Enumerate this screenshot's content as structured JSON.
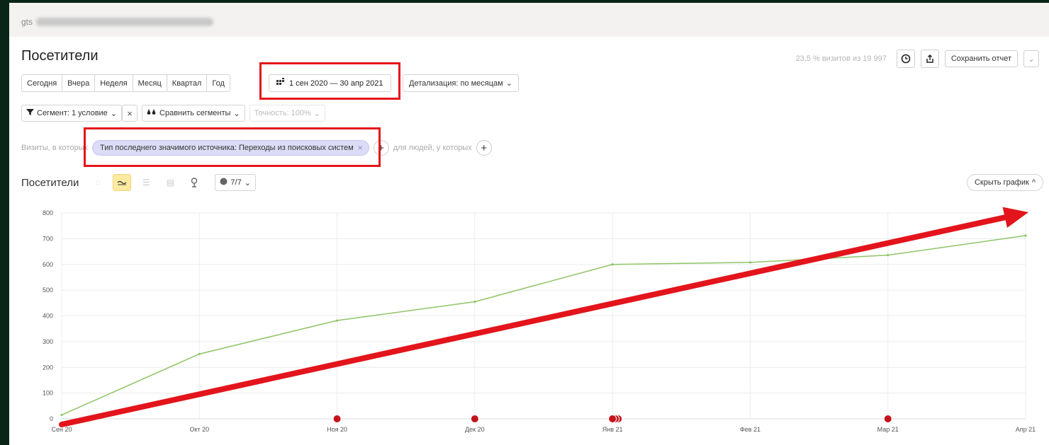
{
  "header": {
    "site_visible": "gts"
  },
  "page_title": "Посетители",
  "topright": {
    "visits_note": "23,5 % визитов из 19 997",
    "history_icon": "clock-icon",
    "export_icon": "share-icon",
    "save_label": "Сохранить отчет",
    "dropdown_icon": "chevron-down-icon"
  },
  "periods": [
    "Сегодня",
    "Вчера",
    "Неделя",
    "Месяц",
    "Квартал",
    "Год"
  ],
  "date_range": {
    "icon": "calendar-icon",
    "label": "1 сен 2020 — 30 апр 2021"
  },
  "detail": {
    "label": "Детализация: по месяцам",
    "chevron": "⌄"
  },
  "segment": {
    "segment_label": "Сегмент: 1 условие",
    "clear": "×",
    "compare_label": "Сравнить сегменты",
    "accuracy_label": "Точность: 100%"
  },
  "filter": {
    "prefix": "Визиты, в которых",
    "chip_label": "Тип последнего значимого источника: Переходы из поисковых систем",
    "chip_close": "×",
    "people_label": "для людей, у которых",
    "plus": "+"
  },
  "chart_toolbar": {
    "label": "Посетители",
    "series_count": "7/7",
    "hide_label": "Скрыть график",
    "hide_chevron": "^"
  },
  "chart_data": {
    "type": "line",
    "x": [
      "Сен 20",
      "Окт 20",
      "Ноя 20",
      "Дек 20",
      "Янв 21",
      "Фев 21",
      "Мар 21",
      "Апр 21"
    ],
    "series": [
      {
        "values": [
          15,
          252,
          382,
          455,
          600,
          608,
          636,
          712
        ]
      }
    ],
    "ylim": [
      0,
      800
    ],
    "yticks": [
      0,
      100,
      200,
      300,
      400,
      500,
      600,
      700,
      800
    ],
    "grid": true,
    "line_color": "#8fc466",
    "arrow_color": "#e3141b",
    "markers": [
      {
        "x": "Ноя 20",
        "count": 1
      },
      {
        "x": "Дек 20",
        "count": 1
      },
      {
        "x": "Янв 21",
        "count": 3
      },
      {
        "x": "Мар 21",
        "count": 1
      }
    ],
    "marker_color": "#c4131b"
  }
}
